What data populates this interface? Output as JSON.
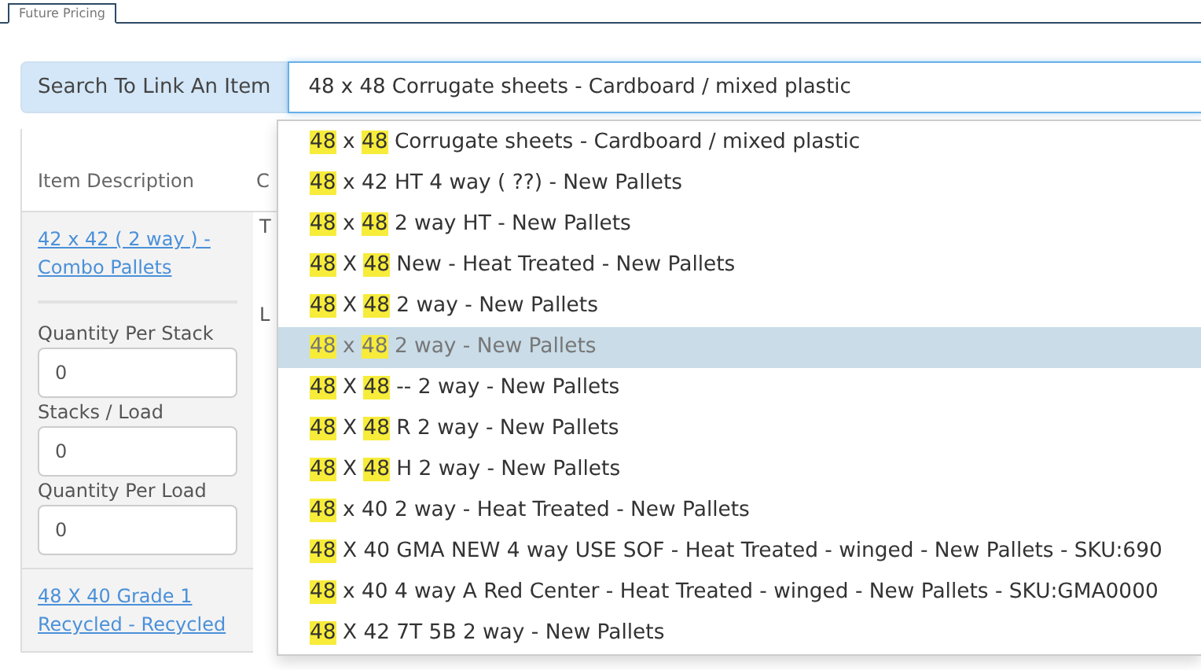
{
  "tabs": [
    {
      "label": "Future Pricing",
      "selected": true
    }
  ],
  "search": {
    "label": "Search To Link An Item",
    "value": "48 x 48 Corrugate sheets - Cardboard / mixed plastic"
  },
  "table": {
    "columns": [
      "Item Description",
      "C"
    ],
    "rows": [
      {
        "item": "42 x 42 ( 2 way ) - Combo Pallets",
        "fields": [
          {
            "label": "Quantity Per Stack",
            "value": "0"
          },
          {
            "label": "Stacks / Load",
            "value": "0"
          },
          {
            "label": "Quantity Per Load",
            "value": "0"
          }
        ],
        "column_2_labels": [
          "T",
          "L"
        ]
      },
      {
        "item": "48 X 40 Grade 1 Recycled - Recycled",
        "fields": [],
        "column_2_labels": []
      }
    ]
  },
  "suggestions": [
    {
      "selected": false,
      "parts": [
        {
          "text": "48",
          "match": true
        },
        {
          "text": " x ",
          "match": false
        },
        {
          "text": "48",
          "match": true
        },
        {
          "text": " Corrugate sheets - Cardboard / mixed plastic",
          "match": false
        }
      ]
    },
    {
      "selected": false,
      "parts": [
        {
          "text": "48",
          "match": true
        },
        {
          "text": " x 42 HT 4 way ( ??) - New Pallets",
          "match": false
        }
      ]
    },
    {
      "selected": false,
      "parts": [
        {
          "text": "48",
          "match": true
        },
        {
          "text": " x ",
          "match": false
        },
        {
          "text": "48",
          "match": true
        },
        {
          "text": " 2 way HT - New Pallets",
          "match": false
        }
      ]
    },
    {
      "selected": false,
      "parts": [
        {
          "text": "48",
          "match": true
        },
        {
          "text": " X ",
          "match": false
        },
        {
          "text": "48",
          "match": true
        },
        {
          "text": " New - Heat Treated - New Pallets",
          "match": false
        }
      ]
    },
    {
      "selected": false,
      "parts": [
        {
          "text": "48",
          "match": true
        },
        {
          "text": " X ",
          "match": false
        },
        {
          "text": "48",
          "match": true
        },
        {
          "text": " 2 way - New Pallets",
          "match": false
        }
      ]
    },
    {
      "selected": true,
      "parts": [
        {
          "text": "48",
          "match": true
        },
        {
          "text": " x ",
          "match": false
        },
        {
          "text": "48",
          "match": true
        },
        {
          "text": " 2 way - New Pallets",
          "match": false
        }
      ]
    },
    {
      "selected": false,
      "parts": [
        {
          "text": "48",
          "match": true
        },
        {
          "text": " X ",
          "match": false
        },
        {
          "text": "48",
          "match": true
        },
        {
          "text": " -- 2 way - New Pallets",
          "match": false
        }
      ]
    },
    {
      "selected": false,
      "parts": [
        {
          "text": "48",
          "match": true
        },
        {
          "text": " X ",
          "match": false
        },
        {
          "text": "48",
          "match": true
        },
        {
          "text": " R 2 way - New Pallets",
          "match": false
        }
      ]
    },
    {
      "selected": false,
      "parts": [
        {
          "text": "48",
          "match": true
        },
        {
          "text": " X ",
          "match": false
        },
        {
          "text": "48",
          "match": true
        },
        {
          "text": " H 2 way - New Pallets",
          "match": false
        }
      ]
    },
    {
      "selected": false,
      "parts": [
        {
          "text": "48",
          "match": true
        },
        {
          "text": " x 40 2 way - Heat Treated - New Pallets",
          "match": false
        }
      ]
    },
    {
      "selected": false,
      "parts": [
        {
          "text": "48",
          "match": true
        },
        {
          "text": " X 40 GMA NEW 4 way USE SOF - Heat Treated - winged - New Pallets - SKU:690",
          "match": false
        }
      ]
    },
    {
      "selected": false,
      "parts": [
        {
          "text": "48",
          "match": true
        },
        {
          "text": " x 40 4 way A Red Center - Heat Treated - winged - New Pallets - SKU:GMA0000",
          "match": false
        }
      ]
    },
    {
      "selected": false,
      "parts": [
        {
          "text": "48",
          "match": true
        },
        {
          "text": " X 42 7T 5B 2 way - New Pallets",
          "match": false
        }
      ]
    }
  ]
}
